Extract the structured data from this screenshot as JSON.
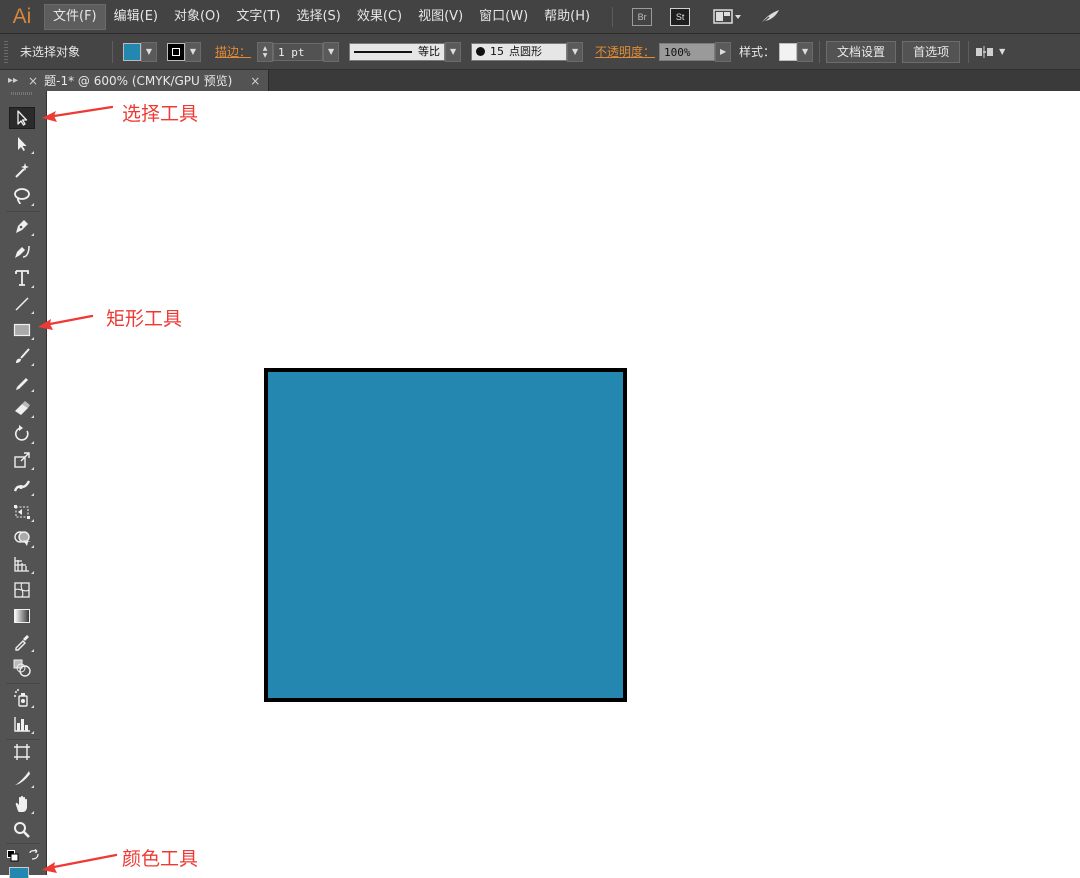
{
  "app": {
    "logo": "Ai"
  },
  "menubar": {
    "items": [
      "文件(F)",
      "编辑(E)",
      "对象(O)",
      "文字(T)",
      "选择(S)",
      "效果(C)",
      "视图(V)",
      "窗口(W)",
      "帮助(H)"
    ],
    "badges": {
      "bridge": "Br",
      "stock": "St"
    }
  },
  "controlbar": {
    "selection_status": "未选择对象",
    "stroke_label": "描边：",
    "stroke_weight": "1 pt",
    "stroke_profile": "等比",
    "brush_size": "15",
    "brush_name": "点圆形",
    "opacity_label": "不透明度：",
    "opacity_value": "100%",
    "style_label": "样式：",
    "doc_setup_button": "文档设置",
    "preferences_button": "首选项"
  },
  "document": {
    "tab_title": "题-1* @ 600% (CMYK/GPU 预览)",
    "close_glyph": "×"
  },
  "tools": [
    "selection-tool",
    "direct-selection-tool",
    "magic-wand-tool",
    "lasso-tool",
    "pen-tool",
    "curvature-tool",
    "type-tool",
    "line-segment-tool",
    "rectangle-tool",
    "paintbrush-tool",
    "pencil-tool",
    "eraser-tool",
    "rotate-tool",
    "scale-tool",
    "width-tool",
    "free-transform-tool",
    "shape-builder-tool",
    "perspective-grid-tool",
    "mesh-tool",
    "gradient-tool",
    "eyedropper-tool",
    "blend-tool",
    "symbol-sprayer-tool",
    "column-graph-tool",
    "artboard-tool",
    "slice-tool",
    "hand-tool",
    "zoom-tool"
  ],
  "colors": {
    "fill": "#2487b0",
    "stroke": "#000000",
    "annotation": "#ee3a35",
    "logo": "#d7863c"
  },
  "annotations": {
    "selection_tool": "选择工具",
    "rectangle_tool": "矩形工具",
    "color_tool": "颜色工具"
  }
}
